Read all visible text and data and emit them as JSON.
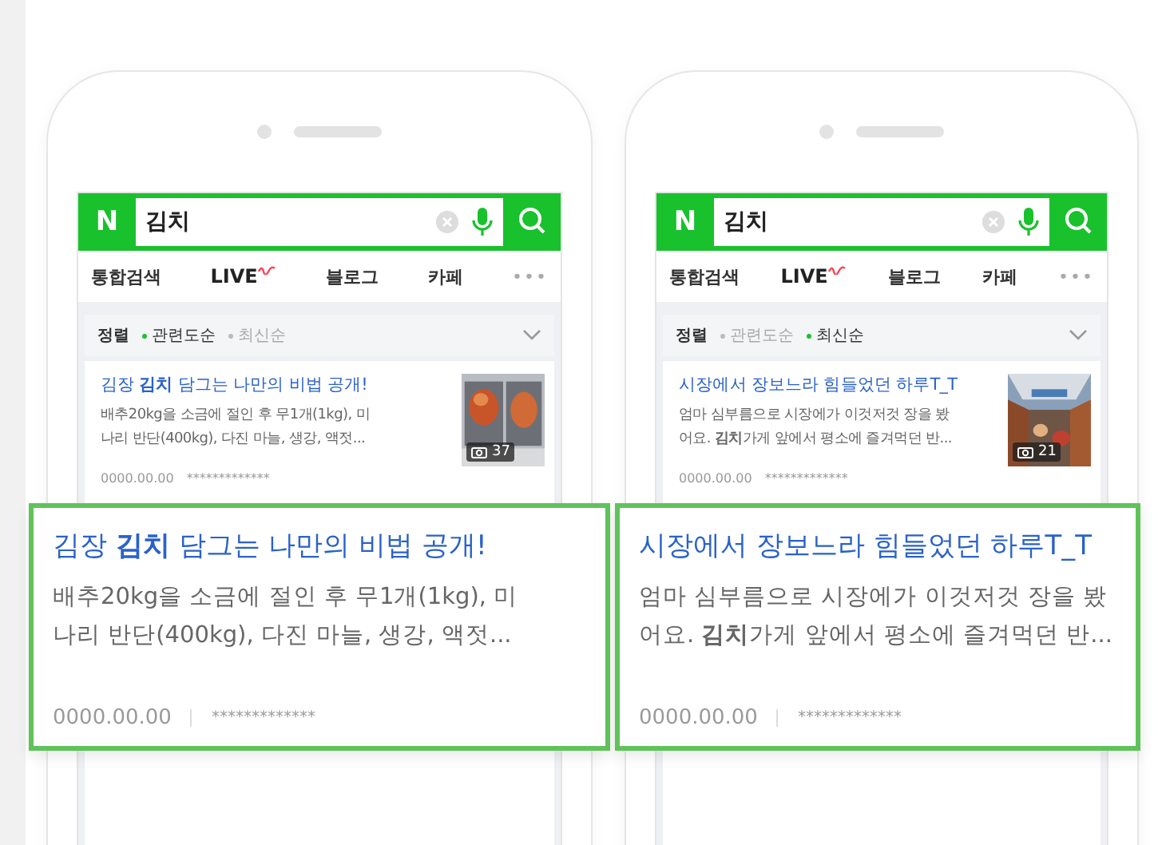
{
  "phones": [
    {
      "search": {
        "logo": "N",
        "query": "김치"
      },
      "tabs": [
        {
          "label": "통합검색",
          "kind": "text"
        },
        {
          "label": "LIVE",
          "kind": "live"
        },
        {
          "label": "블로그",
          "kind": "text"
        },
        {
          "label": "카페",
          "kind": "text"
        },
        {
          "label": "•••",
          "kind": "more"
        }
      ],
      "sort": {
        "label": "정렬",
        "options": [
          {
            "label": "관련도순",
            "selected": true
          },
          {
            "label": "최신순",
            "selected": false
          }
        ]
      },
      "result": {
        "title": "김장 **김치** 담그는 나만의 비법 공개!",
        "snippet_lines": [
          "배추20kg을 소금에 절인 후 무1개(1kg), 미",
          "나리 반단(400kg), 다진 마늘, 생강, 액젓..."
        ],
        "photo_count": "37",
        "date": "0000.00.00",
        "author": "*************"
      },
      "callout": {
        "title": "김장 **김치** 담그는 나만의 비법 공개!",
        "snippet_lines": [
          "배추20kg을 소금에 절인 후 무1개(1kg), 미",
          "나리 반단(400kg), 다진 마늘, 생강, 액젓..."
        ],
        "date": "0000.00.00",
        "author": "*************"
      }
    },
    {
      "search": {
        "logo": "N",
        "query": "김치"
      },
      "tabs": [
        {
          "label": "통합검색",
          "kind": "text"
        },
        {
          "label": "LIVE",
          "kind": "live"
        },
        {
          "label": "블로그",
          "kind": "text"
        },
        {
          "label": "카페",
          "kind": "text"
        },
        {
          "label": "•••",
          "kind": "more"
        }
      ],
      "sort": {
        "label": "정렬",
        "options": [
          {
            "label": "관련도순",
            "selected": false
          },
          {
            "label": "최신순",
            "selected": true
          }
        ]
      },
      "result": {
        "title": "시장에서 장보느라 힘들었던 하루T_T",
        "snippet_lines": [
          "엄마 심부름으로 시장에가 이것저것 장을 봤",
          "어요. **김치**가게 앞에서 평소에 즐겨먹던 반..."
        ],
        "photo_count": "21",
        "date": "0000.00.00",
        "author": "*************"
      },
      "callout": {
        "title": "시장에서 장보느라 힘들었던 하루T_T",
        "snippet_lines": [
          "엄마 심부름으로 시장에가 이것저것 장을 봤",
          "어요. **김치**가게 앞에서 평소에 즐겨먹던 반..."
        ],
        "date": "0000.00.00",
        "author": "*************"
      }
    }
  ]
}
